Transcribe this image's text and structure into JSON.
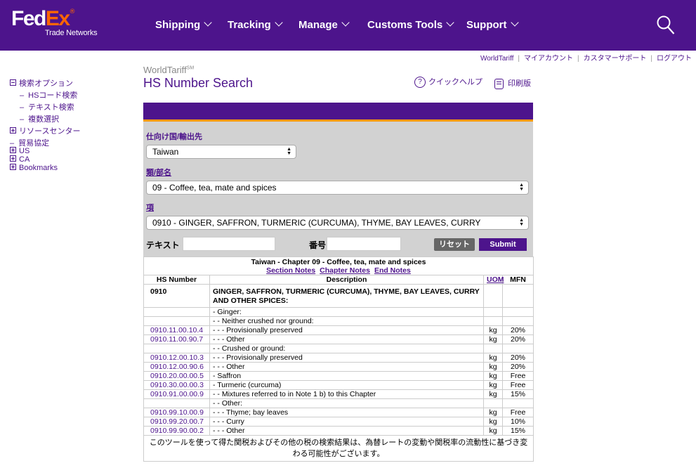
{
  "header": {
    "logo_fed": "Fed",
    "logo_ex": "Ex",
    "logo_reg": "®",
    "logo_sub": "Trade Networks",
    "nav": [
      "Shipping",
      "Tracking",
      "Manage",
      "Customs Tools",
      "Support"
    ]
  },
  "toplinks": [
    "WorldTariff",
    "マイアカウント",
    "カスタマーサポート",
    "ログアウト"
  ],
  "sidebar": {
    "search_options": "検索オプション",
    "hs_code_search": "HSコード検索",
    "text_search": "テキスト検索",
    "multi_select": "複数選択",
    "resource_center": "リソースセンター",
    "trade_agreements": "貿易協定",
    "us": "US",
    "ca": "CA",
    "bookmarks": "Bookmarks"
  },
  "page": {
    "brand": "WorldTariff",
    "brand_sup": "SM",
    "title": "HS Number Search",
    "quick_help": "クイックヘルプ",
    "print": "印刷版"
  },
  "form": {
    "dest_label": "仕向け国/輸出先",
    "dest_value": "Taiwan",
    "chapter_label": "類/部名",
    "chapter_value": "09 - Coffee, tea, mate and spices",
    "heading_label": "項",
    "heading_value": "0910 - GINGER, SAFFRON, TURMERIC (CURCUMA), THYME, BAY LEAVES, CURRY",
    "text_label": "テキスト",
    "number_label": "番号",
    "reset_label": "リセット",
    "submit_label": "Submit"
  },
  "results": {
    "caption": "Taiwan - Chapter 09 - Coffee, tea, mate and spices",
    "links": [
      "Section Notes",
      "Chapter Notes",
      "End Notes"
    ],
    "columns": {
      "hs": "HS Number",
      "desc": "Description",
      "uom": "UOM",
      "mfn": "MFN"
    },
    "heading_hs": "0910",
    "heading_desc": "GINGER, SAFFRON, TURMERIC (CURCUMA), THYME, BAY LEAVES, CURRY AND OTHER SPICES:",
    "rows": [
      {
        "hs": "",
        "desc": "-  Ginger:",
        "uom": "",
        "mfn": ""
      },
      {
        "hs": "",
        "desc": "- -   Neither crushed nor ground:",
        "uom": "",
        "mfn": ""
      },
      {
        "hs": "0910.11.00.10.4",
        "desc": "- - -   Provisionally preserved",
        "uom": "kg",
        "mfn": "20%"
      },
      {
        "hs": "0910.11.00.90.7",
        "desc": "- - -   Other",
        "uom": "kg",
        "mfn": "20%"
      },
      {
        "hs": "",
        "desc": "- -   Crushed or ground:",
        "uom": "",
        "mfn": ""
      },
      {
        "hs": "0910.12.00.10.3",
        "desc": "- - -   Provisionally preserved",
        "uom": "kg",
        "mfn": "20%"
      },
      {
        "hs": "0910.12.00.90.6",
        "desc": "- - -   Other",
        "uom": "kg",
        "mfn": "20%"
      },
      {
        "hs": "0910.20.00.00.5",
        "desc": "-  Saffron",
        "uom": "kg",
        "mfn": "Free"
      },
      {
        "hs": "0910.30.00.00.3",
        "desc": "-  Turmeric (curcuma)",
        "uom": "kg",
        "mfn": "Free"
      },
      {
        "hs": "0910.91.00.00.9",
        "desc": "- -   Mixtures referred to in Note 1 b) to this Chapter",
        "uom": "kg",
        "mfn": "15%"
      },
      {
        "hs": "",
        "desc": "- -   Other:",
        "uom": "",
        "mfn": ""
      },
      {
        "hs": "0910.99.10.00.9",
        "desc": "- - -   Thyme; bay leaves",
        "uom": "kg",
        "mfn": "Free"
      },
      {
        "hs": "0910.99.20.00.7",
        "desc": "- - -   Curry",
        "uom": "kg",
        "mfn": "10%"
      },
      {
        "hs": "0910.99.90.00.2",
        "desc": "- - -   Other",
        "uom": "kg",
        "mfn": "15%"
      }
    ],
    "footnote": "このツールを使って得た関税およびその他の税の検索結果は、為替レートの変動や関税率の流動性に基づき変わる可能性がございます。"
  }
}
